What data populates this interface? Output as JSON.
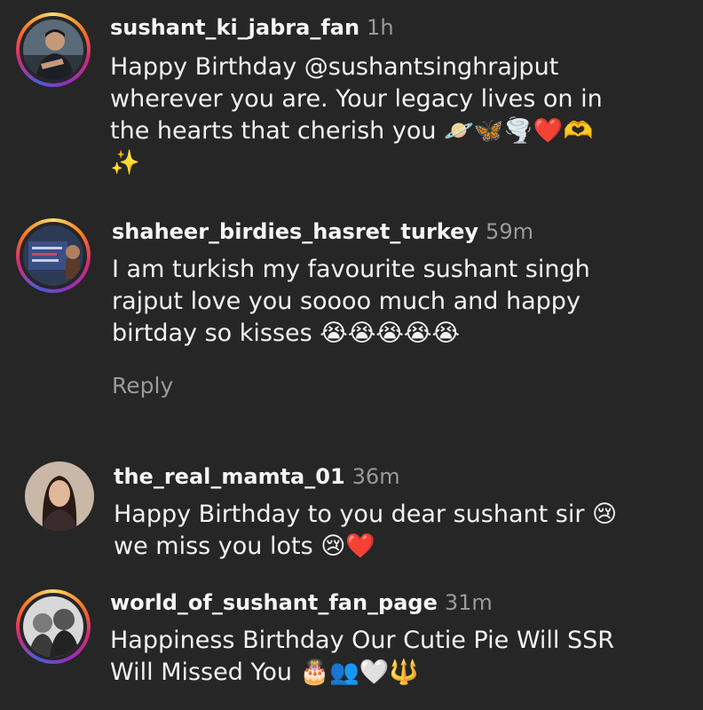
{
  "comments": [
    {
      "username": "sushant_ki_jabra_fan",
      "time": "1h",
      "text": "Happy Birthday @sushantsinghrajput\nwherever you are. Your legacy lives on in\nthe hearts that cherish you 🪐🦋🌪️❤️🫶\n✨",
      "avatar_icon": "profile-photo"
    },
    {
      "username": "shaheer_birdies_hasret_turkey",
      "time": "59m",
      "text": "I am turkish my favourite sushant singh\nrajput love you soooo much and happy\nbirtday so kisses 😭😭😭😭😭",
      "reply_label": "Reply",
      "avatar_icon": "profile-photo"
    },
    {
      "username": "the_real_mamta_01",
      "time": "36m",
      "text": "Happy Birthday to you dear sushant sir 😢\nwe miss you lots 😢❤️",
      "avatar_icon": "profile-photo"
    },
    {
      "username": "world_of_sushant_fan_page",
      "time": "31m",
      "text": "Happiness Birthday Our Cutie Pie Will SSR\nWill Missed You 🎂👥🤍🔱",
      "avatar_icon": "profile-photo"
    }
  ],
  "colors": {
    "background": "#262626",
    "text": "#f5f5f5",
    "muted": "#9a9a9a"
  }
}
